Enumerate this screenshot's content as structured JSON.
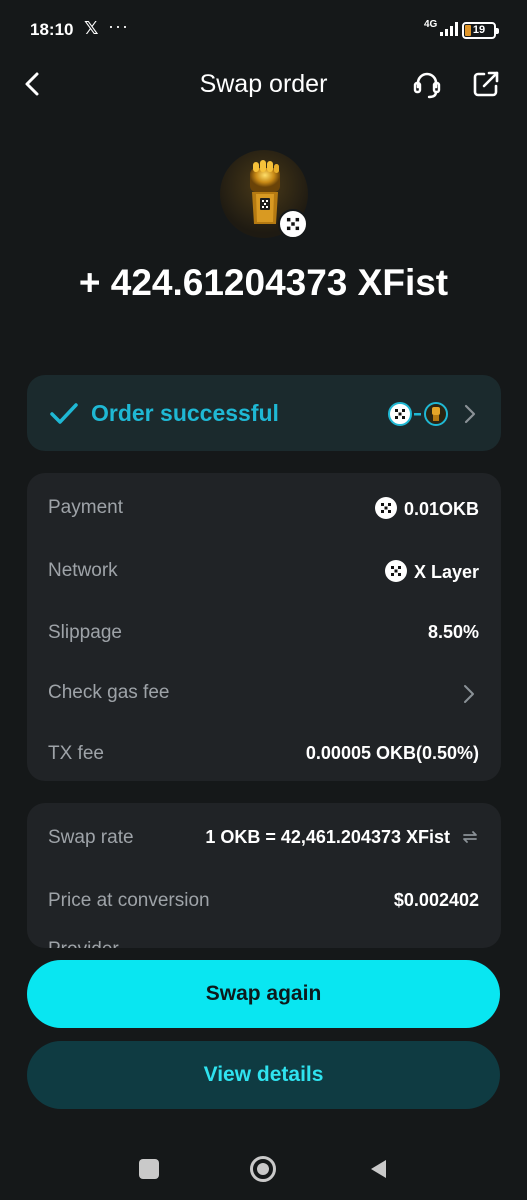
{
  "status_bar": {
    "time": "18:10",
    "x_logo": "𝕏",
    "more": "···",
    "network": "4G",
    "battery": "19"
  },
  "header": {
    "title": "Swap order"
  },
  "summary": {
    "amount": "+ 424.61204373 XFist"
  },
  "status": {
    "text": "Order successful",
    "color": "#1fb8d4"
  },
  "details": {
    "rows": [
      {
        "label": "Payment",
        "value": "0.01OKB"
      },
      {
        "label": "Network",
        "value": "X Layer"
      },
      {
        "label": "Slippage",
        "value": "8.50%"
      },
      {
        "label": "Check gas fee",
        "value": ""
      },
      {
        "label": "TX fee",
        "value": "0.00005 OKB(0.50%)"
      }
    ]
  },
  "rates": {
    "rows": [
      {
        "label": "Swap rate",
        "value": "1 OKB = 42,461.204373 XFist"
      },
      {
        "label": "Price at conversion",
        "value": "$0.002402"
      }
    ],
    "partial_label": "Provider"
  },
  "actions": {
    "primary": "Swap again",
    "secondary": "View details"
  },
  "icons": {
    "back": "chevron-left-icon",
    "support": "headset-icon",
    "share": "external-link-icon",
    "check": "check-icon",
    "refresh": "swap-arrows-icon"
  },
  "colors": {
    "accent": "#09e6f1",
    "background": "#151819",
    "card": "#202326"
  }
}
